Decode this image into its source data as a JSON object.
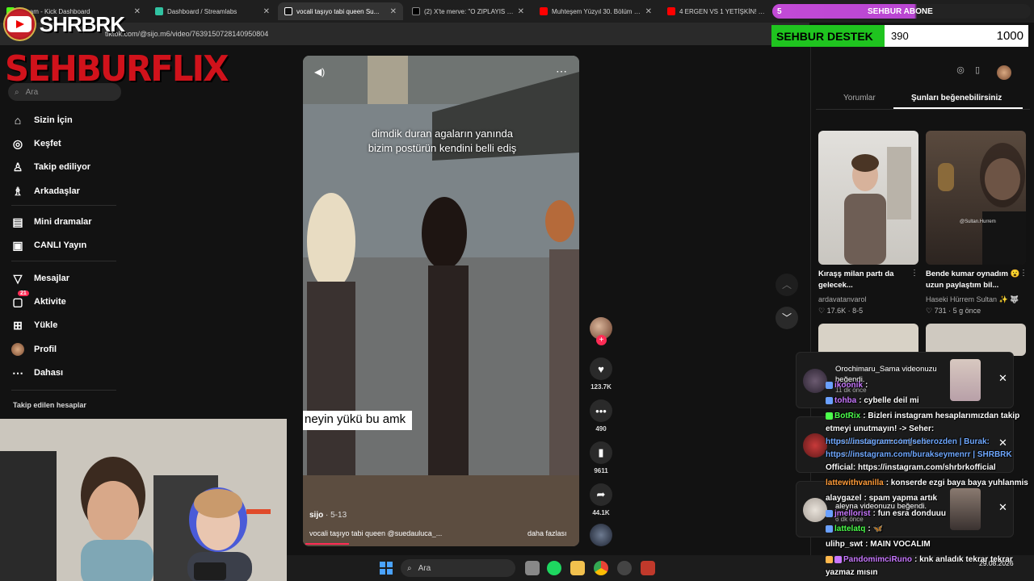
{
  "tabs": [
    {
      "label": "...ream - Kick Dashboard",
      "color": "#53fc18",
      "active": false
    },
    {
      "label": "Dashboard / Streamlabs",
      "color": "#31c3a2",
      "active": false
    },
    {
      "label": "vocali taşıyo tabi queen Su...",
      "color": "#111111",
      "active": true
    },
    {
      "label": "(2) X'te merve: \"O ZIPLAYIS NE...",
      "color": "#000000",
      "active": false
    },
    {
      "label": "Muhteşem Yüzyıl 30. Bölüm (4K...",
      "color": "#ff0000",
      "active": false
    },
    {
      "label": "4 ERGEN VS 1 YETİŞKİN! | HANG...",
      "color": "#ff0000",
      "active": false
    }
  ],
  "url": "tiktok.com/@sijo.m6/video/7639150728140950804",
  "overlay": {
    "logo_text": "SHRBRK",
    "sehburflix": "SEHBURFLIX",
    "abone_count": "5",
    "abone_label": "SEHBUR ABONE",
    "destek_label": "SEHBUR DESTEK",
    "destek_current": "390",
    "destek_goal": "1000"
  },
  "sidebar": {
    "search_placeholder": "Ara",
    "items": [
      {
        "label": "Sizin İçin",
        "icon": "home-icon",
        "glyph": "⌂"
      },
      {
        "label": "Keşfet",
        "icon": "compass-icon",
        "glyph": "◎"
      },
      {
        "label": "Takip ediliyor",
        "icon": "following-icon",
        "glyph": "👤"
      },
      {
        "label": "Arkadaşlar",
        "icon": "friends-icon",
        "glyph": "👥"
      },
      {
        "label": "Mini dramalar",
        "icon": "mini-drama-icon",
        "glyph": "▤"
      },
      {
        "label": "CANLI Yayın",
        "icon": "live-icon",
        "glyph": "▣"
      },
      {
        "label": "Mesajlar",
        "icon": "messages-icon",
        "glyph": "▽"
      },
      {
        "label": "Aktivite",
        "icon": "activity-icon",
        "glyph": "▢",
        "badge": "21"
      },
      {
        "label": "Yükle",
        "icon": "upload-icon",
        "glyph": "⊞"
      },
      {
        "label": "Profil",
        "icon": "profile-icon",
        "glyph": "●"
      },
      {
        "label": "Dahası",
        "icon": "more-icon",
        "glyph": "⋯"
      }
    ],
    "followed_heading": "Takip edilen hesaplar"
  },
  "video": {
    "caption": "dimdik duran agaların yanında bizim postürün kendini belli ediş",
    "subtitle": "neyin yükü bu amk",
    "author": "sijo",
    "date": " · 5-13",
    "description": "vocali taşıyo tabi queen @suedaulucа_...",
    "more": "daha fazlası",
    "progress": 0.16
  },
  "actions": {
    "likes": "123.7K",
    "comments": "490",
    "saves": "9611",
    "shares": "44.1K"
  },
  "right_panel": {
    "tab_comments": "Yorumlar",
    "tab_likes": "Şunları beğenebilirsiniz",
    "cards": [
      {
        "title": "Kıraşş milan partı da gelecek...",
        "author": "ardavatanvarol",
        "stats": "♡ 17.6K · 8-5"
      },
      {
        "title": "Bende kumar oynadım 😮 uzun paylaştım bil...",
        "author": "Haseki Hürrem Sultan ✨ 🐺",
        "stats": "♡ 731 · 5 g önce"
      }
    ],
    "thumb_watermark": "@Sultan.Hurrem"
  },
  "notifications": [
    {
      "text": "Orochimaru_Sama videonuzu beğendi.",
      "sub": "11 dk önce"
    },
    {
      "text": "matcha videonuzu beğendi.",
      "sub": "8 dk önce"
    },
    {
      "text": "aleyna videonuzu beğendi.",
      "sub": "6 dk önce"
    }
  ],
  "chat": [
    {
      "user": "ikoonik",
      "text": ":",
      "color": "#c878ff"
    },
    {
      "user": "tohba",
      "text": ": cybelle deil mi",
      "color": "#c878ff"
    },
    {
      "user": "BotRix",
      "text": ": Bizleri instagram hesaplarımızdan takip",
      "color": "#4cff4c"
    },
    {
      "user": "",
      "text": "etmeyi unutmayın! -> Seher:",
      "color": "#ffffff"
    },
    {
      "user": "",
      "text": "https://instagram.com/seherozden | Burak:",
      "color": "#ffffff",
      "link": true
    },
    {
      "user": "",
      "text": "https://instagram.com/burakseymenrr | SHRBRK",
      "color": "#ffffff",
      "link": true
    },
    {
      "user": "",
      "text": "Official: https://instagram.com/shrbrkofficial",
      "color": "#ffffff"
    },
    {
      "user": "lattewithvanilla",
      "text": ": konserde ezgi baya baya yuhlanmis",
      "color": "#ff9c3a"
    },
    {
      "user": "alaygazel",
      "text": ": spam yapma artık",
      "color": "#ffffff"
    },
    {
      "user": "jmellorist",
      "text": ": fun esra donduuu",
      "color": "#c878ff"
    },
    {
      "user": "lattelatq",
      "text": ": 🦋",
      "color": "#4cff4c"
    },
    {
      "user": "ulihp_swt",
      "text": ": MAIN VOCALIM",
      "color": "#ffffff"
    },
    {
      "user": "PandomimciRuno",
      "text": ": knk anladık tekrar tekrar",
      "color": "#c878ff"
    },
    {
      "user": "",
      "text": "yazmaz mısın",
      "color": "#ffffff"
    }
  ],
  "taskbar": {
    "search_placeholder": "Ara",
    "date": "29.08.2026"
  },
  "colors": {
    "accent": "#fe2c55",
    "brand_red": "#d0121b",
    "abone_purple": "#c24ad6",
    "destek_green": "#1fc41f"
  }
}
